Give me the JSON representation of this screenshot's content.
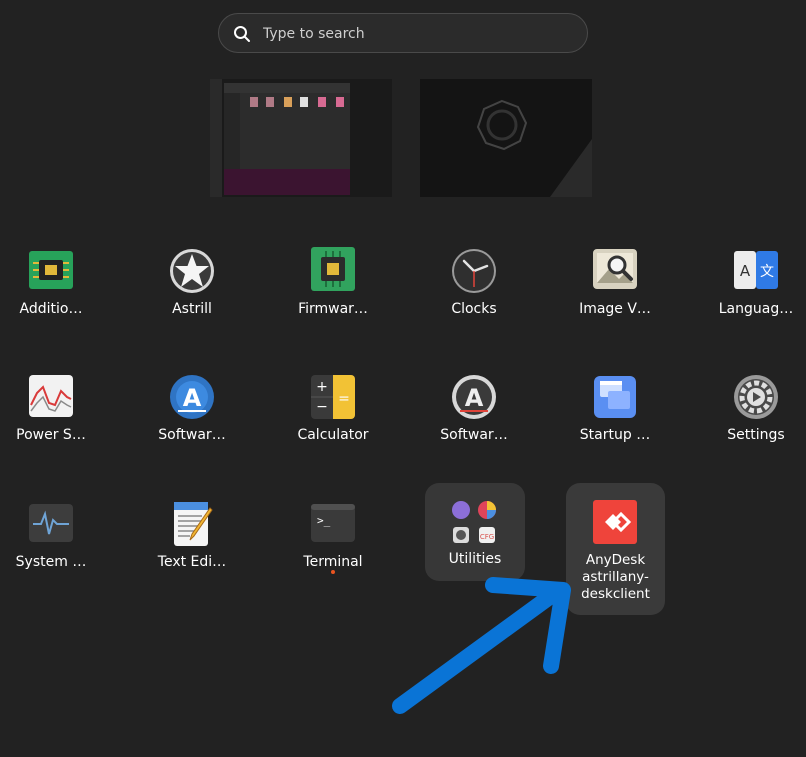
{
  "search": {
    "placeholder": "Type to search",
    "icon": "search-icon"
  },
  "workspaces": [
    {
      "name": "workspace-1"
    },
    {
      "name": "workspace-2"
    }
  ],
  "apps": [
    {
      "label": "Additio…",
      "icon": "chip-icon"
    },
    {
      "label": "Astrill",
      "icon": "star-icon"
    },
    {
      "label": "Firmwar…",
      "icon": "firmware-chip-icon"
    },
    {
      "label": "Clocks",
      "icon": "clock-icon"
    },
    {
      "label": "Image V…",
      "icon": "image-viewer-icon"
    },
    {
      "label": "Languag…",
      "icon": "language-icon"
    },
    {
      "label": "Power S…",
      "icon": "power-stats-icon"
    },
    {
      "label": "Softwar…",
      "icon": "software-store-icon"
    },
    {
      "label": "Calculator",
      "icon": "calculator-icon"
    },
    {
      "label": "Softwar…",
      "icon": "software-updater-icon"
    },
    {
      "label": "Startup …",
      "icon": "startup-icon"
    },
    {
      "label": "Settings",
      "icon": "gear-icon"
    },
    {
      "label": "System …",
      "icon": "system-monitor-icon"
    },
    {
      "label": "Text Edi…",
      "icon": "text-editor-icon"
    },
    {
      "label": "Terminal",
      "icon": "terminal-icon"
    }
  ],
  "folder": {
    "label": "Utilities",
    "icon": "folder-grid-icon"
  },
  "selected_app": {
    "line1": "AnyDesk",
    "line2": "astrillany-",
    "line3": "deskclient",
    "icon": "anydesk-icon"
  },
  "colors": {
    "background": "#222222",
    "accent": "#e95420",
    "arrow": "#0a74d6",
    "anydesk": "#ef443b"
  }
}
